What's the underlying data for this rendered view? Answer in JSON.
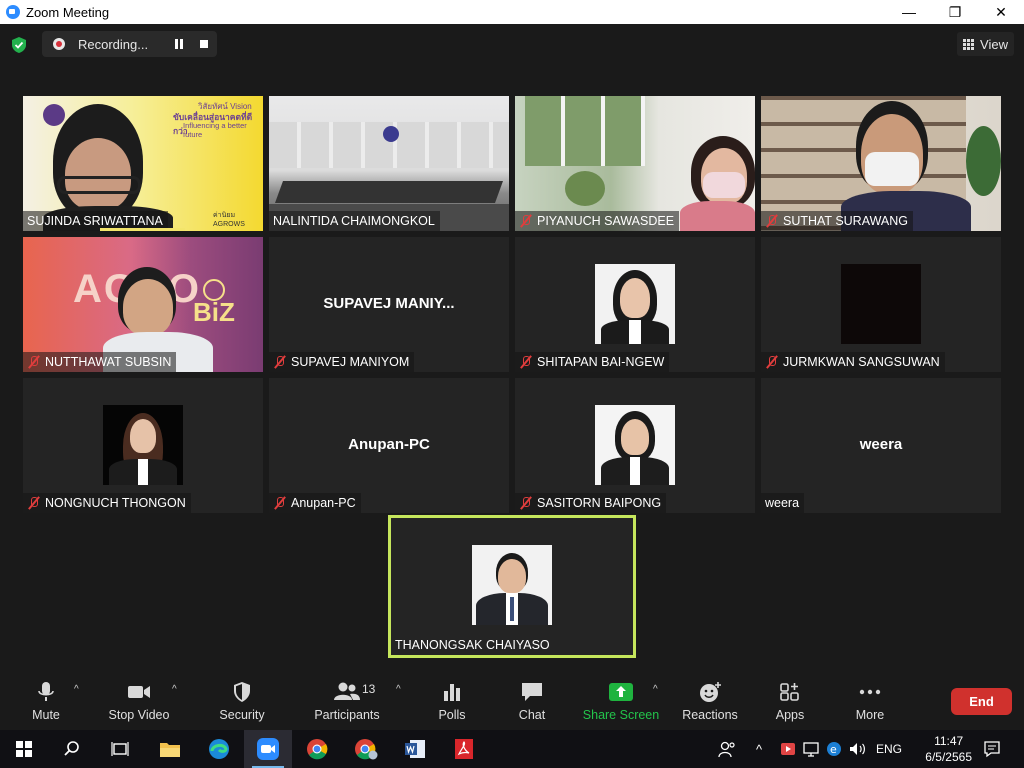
{
  "window": {
    "title": "Zoom Meeting",
    "minimize": "—",
    "maximize": "❐",
    "close": "✕"
  },
  "meeting_header": {
    "recording_label": "Recording...",
    "view_label": "View"
  },
  "tiles": [
    {
      "name": "SUJINDA SRIWATTANA",
      "muted": false
    },
    {
      "name": "NALINTIDA CHAIMONGKOL",
      "muted": false
    },
    {
      "name": "PIYANUCH SAWASDEE",
      "muted": true
    },
    {
      "name": "SUTHAT SURAWANG",
      "muted": true
    },
    {
      "name": "NUTTHAWAT SUBSIN",
      "muted": true
    },
    {
      "name": "SUPAVEJ MANIYOM",
      "muted": true,
      "display": "SUPAVEJ  MANIY..."
    },
    {
      "name": "SHITAPAN BAI-NGEW",
      "muted": true
    },
    {
      "name": "JURMKWAN SANGSUWAN",
      "muted": true
    },
    {
      "name": "NONGNUCH THONGON",
      "muted": true
    },
    {
      "name": "Anupan-PC",
      "muted": true,
      "display": "Anupan-PC"
    },
    {
      "name": "SASITORN BAIPONG",
      "muted": true
    },
    {
      "name": "weera",
      "muted": false,
      "display": "weera"
    },
    {
      "name": "THANONGSAK CHAIYASO",
      "muted": false,
      "active": true
    }
  ],
  "slide_text": {
    "vision_line": "วิสัยทัศน์ Vision",
    "thai_line": "ขับเคลื่อนสู่อนาคตที่ดีกว่า",
    "eng_line": "Influencing a better future",
    "agrows": "ค่านิยม AGROWS",
    "agro_sign": "AGRO",
    "biz_sign": "BiZ"
  },
  "toolbar": {
    "mute": "Mute",
    "stop_video": "Stop Video",
    "security": "Security",
    "participants": "Participants",
    "participants_count": "13",
    "polls": "Polls",
    "chat": "Chat",
    "share_screen": "Share Screen",
    "reactions": "Reactions",
    "apps": "Apps",
    "more": "More",
    "end": "End"
  },
  "taskbar": {
    "lang": "ENG",
    "time": "11:47",
    "date": "6/5/2565"
  },
  "colors": {
    "share_green": "#1fb33f",
    "end_red": "#d0312d",
    "active_speaker": "#c5e65c",
    "muted_red": "#e03d3d"
  }
}
